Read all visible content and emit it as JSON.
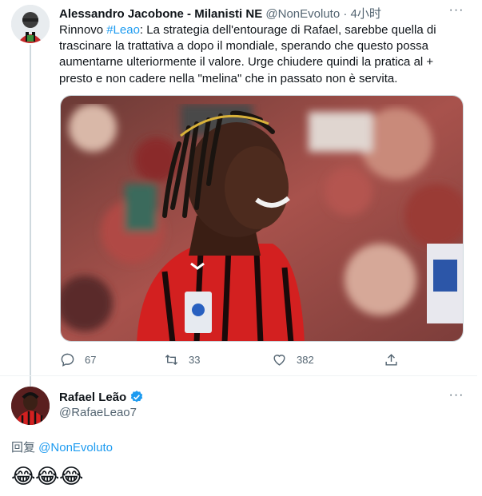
{
  "tweet": {
    "author_name": "Alessandro Jacobone - Milanisti NE",
    "handle": "@NonEvoluto",
    "separator": "·",
    "time": "4小时",
    "text_before_tag": "Rinnovo ",
    "hashtag": "#Leao",
    "text_after_tag": ": La strategia dell'entourage di Rafael, sarebbe quella di trascinare la trattativa a dopo il mondiale, sperando che questo possa aumentarne ulteriormente il valore. Urge chiudere quindi la pratica al + presto e non cadere nella \"melina\" che in passato non è servita.",
    "photo_icon": "player-photo",
    "actions": {
      "reply_count": "67",
      "retweet_count": "33",
      "like_count": "382"
    }
  },
  "reply": {
    "author_name": "Rafael Leão",
    "handle": "@RafaeLeao7",
    "reply_prefix": "回复 ",
    "reply_to": "@NonEvoluto",
    "emojis": [
      "😂",
      "😂",
      "😂"
    ]
  },
  "colors": {
    "link": "#1d9bf0",
    "secondary_text": "#536471",
    "divider": "#eff3f4",
    "verified": "#1d9bf0"
  }
}
